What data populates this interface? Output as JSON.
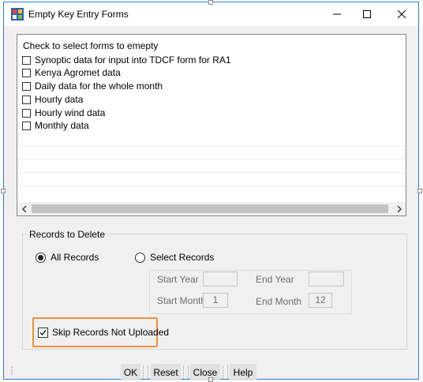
{
  "window": {
    "title": "Empty Key Entry Forms",
    "minimize_icon": "minimize-icon",
    "maximize_icon": "maximize-icon",
    "close_icon": "close-icon"
  },
  "forms_list": {
    "header": "Check to select  forms to emepty",
    "items": [
      {
        "label": "Synoptic data for input into  TDCF form for RA1",
        "checked": false
      },
      {
        "label": "Kenya Agromet data",
        "checked": false
      },
      {
        "label": "Daily data for the whole month",
        "checked": false
      },
      {
        "label": "Hourly data",
        "checked": false
      },
      {
        "label": "Hourly wind data",
        "checked": false
      },
      {
        "label": "Monthly data",
        "checked": false
      }
    ],
    "scroll_left_icon": "chevron-left-icon",
    "scroll_right_icon": "chevron-right-icon"
  },
  "records": {
    "group_label": "Records to Delete",
    "all_records_label": "All Records",
    "all_records_selected": true,
    "select_records_label": "Select Records",
    "select_records_selected": false,
    "start_year_label": "Start Year",
    "start_year_value": "",
    "end_year_label": "End Year",
    "end_year_value": "",
    "start_month_label": "Start Month",
    "start_month_value": "1",
    "end_month_label": "End Month",
    "end_month_value": "12"
  },
  "skip": {
    "label": "Skip Records Not Uploaded",
    "checked": true,
    "highlight_color": "#f0903a"
  },
  "footer": {
    "ok_label": "OK",
    "reset_label": "Reset",
    "close_label": "Close",
    "help_label": "Help"
  }
}
